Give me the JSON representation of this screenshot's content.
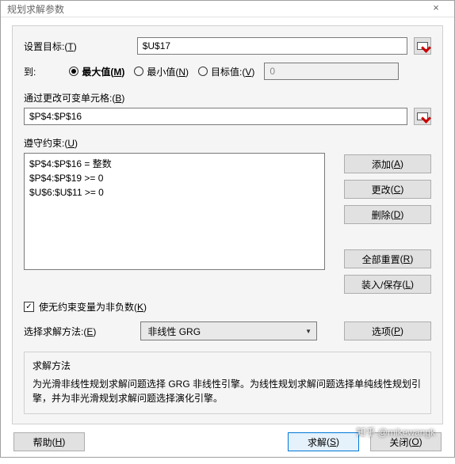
{
  "window": {
    "title": "规划求解参数",
    "close": "×"
  },
  "objective": {
    "label": "设置目标:",
    "key": "T",
    "value": "$U$17"
  },
  "to": {
    "label": "到:",
    "max": "最大值",
    "maxKey": "M",
    "min": "最小值",
    "minKey": "N",
    "target": "目标值:",
    "targetKey": "V",
    "targetValue": "0",
    "selected": "max"
  },
  "cells": {
    "label": "通过更改可变单元格:",
    "key": "B",
    "value": "$P$4:$P$16"
  },
  "constraints": {
    "label": "遵守约束:",
    "key": "U",
    "items": [
      "$P$4:$P$16 = 整数",
      "$P$4:$P$19 >= 0",
      "$U$6:$U$11 >= 0"
    ]
  },
  "buttons": {
    "add": "添加",
    "addKey": "A",
    "change": "更改",
    "changeKey": "C",
    "delete": "删除",
    "deleteKey": "D",
    "reset": "全部重置",
    "resetKey": "R",
    "load": "装入/保存",
    "loadKey": "L",
    "options": "选项",
    "optionsKey": "P",
    "help": "帮助",
    "helpKey": "H",
    "solve": "求解",
    "solveKey": "S",
    "close": "关闭",
    "closeKey": "O"
  },
  "nonneg": {
    "label": "使无约束变量为非负数",
    "key": "K",
    "checked": true
  },
  "method": {
    "label": "选择求解方法:",
    "key": "E",
    "value": "非线性 GRG"
  },
  "desc": {
    "title": "求解方法",
    "text": "为光滑非线性规划求解问题选择 GRG 非线性引擎。为线性规划求解问题选择单纯线性规划引擎，并为非光滑规划求解问题选择演化引擎。"
  },
  "watermark": "知乎 @mikewangk"
}
